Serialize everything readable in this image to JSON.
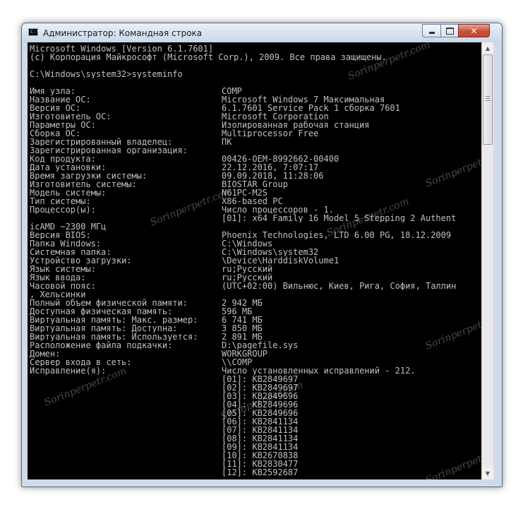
{
  "window": {
    "title": "Администратор: Командная строка",
    "icon_text": "C:\\",
    "controls": {
      "minimize": "minimize-icon",
      "maximize": "maximize-icon",
      "close": "close-icon"
    }
  },
  "console": {
    "header": [
      "Microsoft Windows [Version 6.1.7601]",
      "(c) Корпорация Майкрософт (Microsoft Corp.), 2009. Все права защищены.",
      "",
      "C:\\Windows\\system32>systeminfo",
      ""
    ],
    "rows": [
      {
        "label": "Имя узла:",
        "value": "COMP"
      },
      {
        "label": "Название ОС:",
        "value": "Microsoft Windows 7 Максимальная"
      },
      {
        "label": "Версия ОС:",
        "value": "6.1.7601 Service Pack 1 сборка 7601"
      },
      {
        "label": "Изготовитель ОС:",
        "value": "Microsoft Corporation"
      },
      {
        "label": "Параметры ОС:",
        "value": "Изолированная рабочая станция"
      },
      {
        "label": "Сборка ОС:",
        "value": "Multiprocessor Free"
      },
      {
        "label": "Зарегистрированный владелец:",
        "value": "ПК"
      },
      {
        "label": "Зарегистрированная организация:",
        "value": ""
      },
      {
        "label": "Код продукта:",
        "value": "00426-OEM-8992662-00400"
      },
      {
        "label": "Дата установки:",
        "value": "22.12.2016, 7:07:17"
      },
      {
        "label": "Время загрузки системы:",
        "value": "09.09.2018, 11:28:06"
      },
      {
        "label": "Изготовитель системы:",
        "value": "BIOSTAR Group"
      },
      {
        "label": "Модель системы:",
        "value": "N61PC-M2S"
      },
      {
        "label": "Тип системы:",
        "value": "X86-based PC"
      },
      {
        "label": "Процессор(ы):",
        "value": "Число процессоров - 1."
      },
      {
        "label": "",
        "value": "[01]: x64 Family 16 Model 5 Stepping 2 Authent"
      },
      {
        "raw": "icAMD ~2300 МГц"
      },
      {
        "label": "Версия BIOS:",
        "value": "Phoenix Technologies, LTD 6.00 PG, 18.12.2009"
      },
      {
        "label": "Папка Windows:",
        "value": "C:\\Windows"
      },
      {
        "label": "Системная папка:",
        "value": "C:\\Windows\\system32"
      },
      {
        "label": "Устройство загрузки:",
        "value": "\\Device\\HarddiskVolume1"
      },
      {
        "label": "Язык системы:",
        "value": "ru;Русский"
      },
      {
        "label": "Язык ввода:",
        "value": "ru;Русский"
      },
      {
        "label": "Часовой пояс:",
        "value": "(UTC+02:00) Вильнюс, Киев, Рига, София, Таллин"
      },
      {
        "raw": ", Хельсинки"
      },
      {
        "label": "Полный объем физической памяти:",
        "value": "2 942 МБ"
      },
      {
        "label": "Доступная физическая память:",
        "value": "596 МБ"
      },
      {
        "label": "Виртуальная память: Макс. размер:",
        "value": "6 741 МБ"
      },
      {
        "label": "Виртуальная память: Доступна:",
        "value": "3 850 МБ"
      },
      {
        "label": "Виртуальная память: Используется:",
        "value": "2 891 МБ"
      },
      {
        "label": "Расположение файла подкачки:",
        "value": "D:\\pagefile.sys"
      },
      {
        "label": "Домен:",
        "value": "WORKGROUP"
      },
      {
        "label": "Сервер входа в сеть:",
        "value": "\\\\COMP"
      },
      {
        "label": "Исправление(я):",
        "value": "Число установленных исправлений - 212."
      },
      {
        "label": "",
        "value": "[01]: KB2849697"
      },
      {
        "label": "",
        "value": "[02]: KB2849697"
      },
      {
        "label": "",
        "value": "[03]: KB2849696"
      },
      {
        "label": "",
        "value": "[04]: KB2849696"
      },
      {
        "label": "",
        "value": "[05]: KB2849696"
      },
      {
        "label": "",
        "value": "[06]: KB2841134"
      },
      {
        "label": "",
        "value": "[07]: KB2841134"
      },
      {
        "label": "",
        "value": "[08]: KB2841134"
      },
      {
        "label": "",
        "value": "[09]: KB2841134"
      },
      {
        "label": "",
        "value": "[10]: KB2670838"
      },
      {
        "label": "",
        "value": "[11]: KB2830477"
      },
      {
        "label": "",
        "value": "[12]: KB2592687"
      }
    ]
  },
  "watermark": "Sorinperpetr.com",
  "colors": {
    "console_bg": "#000000",
    "console_text": "#c0c0c0",
    "titlebar": "#cfdbe9",
    "close_button": "#c7503b"
  }
}
